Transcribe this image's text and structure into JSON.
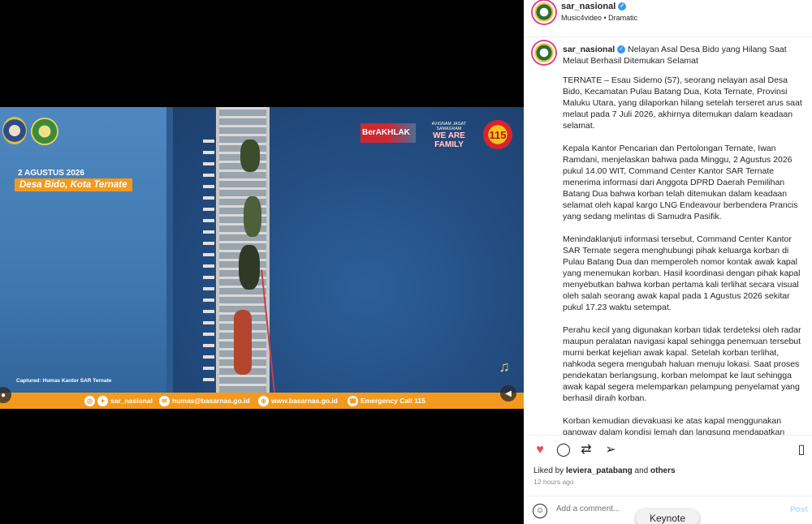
{
  "video": {
    "date_text": "2 AGUSTUS 2026",
    "location_tag": "Desa Bido, Kota Ternate",
    "berakhlak": "BerAKHLAK",
    "tagline_small": "AVIGNAM JAGAT SAMAGRAM",
    "tagline_big": "WE ARE FAMILY",
    "badge_115": "115",
    "captured": "Captured: Humas Kantor SAR Ternate",
    "footer": {
      "instagram": "sar_nasional",
      "email": "humas@basarnas.go.id",
      "web": "www.basarnas.go.id",
      "emergency": "Emergency Call 115"
    }
  },
  "header": {
    "username": "sar_nasional",
    "subtitle": "Music4video • Dramatic"
  },
  "caption": {
    "username": "sar_nasional",
    "title": "Nelayan Asal Desa Bido yang Hilang Saat Melaut Berhasil Ditemukan Selamat",
    "paragraphs": [
      "TERNATE – Esau Sidemo (57), seorang nelayan asal Desa Bido, Kecamatan Pulau Batang Dua, Kota Ternate, Provinsi Maluku Utara, yang dilaporkan hilang setelah terseret arus saat melaut pada 7 Juli 2026, akhirnya ditemukan dalam keadaan selamat.",
      "Kepala Kantor Pencarian dan Pertolongan Ternate, Iwan Ramdani, menjelaskan bahwa pada Minggu, 2 Agustus 2026 pukul 14.00 WIT, Command Center Kantor SAR Ternate menerima informasi dari Anggota DPRD Daerah Pemilihan Batang Dua bahwa korban telah ditemukan dalam keadaan selamat oleh kapal kargo LNG Endeavour berbendera Prancis yang sedang melintas di Samudra Pasifik.",
      "Menindaklanjuti informasi tersebut, Command Center Kantor SAR Ternate segera menghubungi pihak keluarga korban di Pulau Batang Dua dan memperoleh nomor kontak awak kapal yang menemukan korban. Hasil koordinasi dengan pihak kapal menyebutkan bahwa korban pertama kali terlihat secara visual oleh salah seorang awak kapal pada 1 Agustus 2026 sekitar pukul 17.23 waktu setempat.",
      "Perahu kecil yang digunakan korban tidak terdeteksi oleh radar maupun peralatan navigasi kapal sehingga penemuan tersebut murni berkat kejelian awak kapal. Setelah korban terlihat, nahkoda segera mengubah haluan menuju lokasi. Saat proses pendekatan berlangsung, korban melompat ke laut sehingga awak kapal segera melemparkan pelampung penyelamat yang berhasil diraih korban.",
      "Korban kemudian dievakuasi ke atas kapal menggunakan gangway dalam kondisi lemah dan langsung mendapatkan pertolongan pertama. Selanjutnya, korban dibawa ke rumah sakit kapal untuk memperoleh penanganan medis berdasarkan"
    ]
  },
  "likes": {
    "prefix": "Liked by",
    "user": "leviera_patabang",
    "joiner": "and",
    "others": "others"
  },
  "time_ago": "12 hours ago",
  "comment": {
    "placeholder": "Add a comment...",
    "post_label": "Post"
  },
  "keynote_label": "Keynote",
  "colors": {
    "accent_orange": "#f39a1e",
    "like_red": "#ed4956",
    "verified_blue": "#3897f0"
  }
}
